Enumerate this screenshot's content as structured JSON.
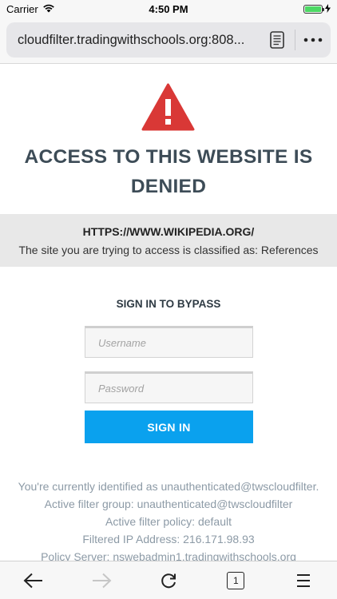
{
  "status": {
    "carrier": "Carrier",
    "time": "4:50 PM",
    "battery_level": 1.0
  },
  "browser": {
    "url": "cloudfilter.tradingwithschools.org:808...",
    "tab_count": "1",
    "icons": {
      "reader": "reader-icon",
      "more": "more-icon",
      "back": "back-arrow-icon",
      "forward": "forward-arrow-icon",
      "reload": "reload-icon",
      "tabs": "tabs-icon",
      "menu": "menu-icon"
    }
  },
  "page": {
    "title": "ACCESS TO THIS WEBSITE IS DENIED",
    "blocked_url": "HTTPS://WWW.WIKIPEDIA.ORG/",
    "blocked_desc": "The site you are trying to access is classified as: References",
    "signin_heading": "SIGN IN TO BYPASS",
    "username_placeholder": "Username",
    "password_placeholder": "Password",
    "signin_label": "SIGN IN",
    "info": {
      "identified": "You're currently identified as unauthenticated@twscloudfilter.",
      "filter_group": "Active filter group: unauthenticated@twscloudfilter",
      "filter_policy": "Active filter policy: default",
      "ip": "Filtered IP Address: 216.171.98.93",
      "server": "Policy Server: nswebadmin1.tradingwithschools.org"
    }
  },
  "colors": {
    "title": "#3d4c57",
    "warning": "#d93836",
    "button": "#0aa1ee",
    "info_text": "#8c9aa6",
    "banner_bg": "#e8e8e8"
  }
}
